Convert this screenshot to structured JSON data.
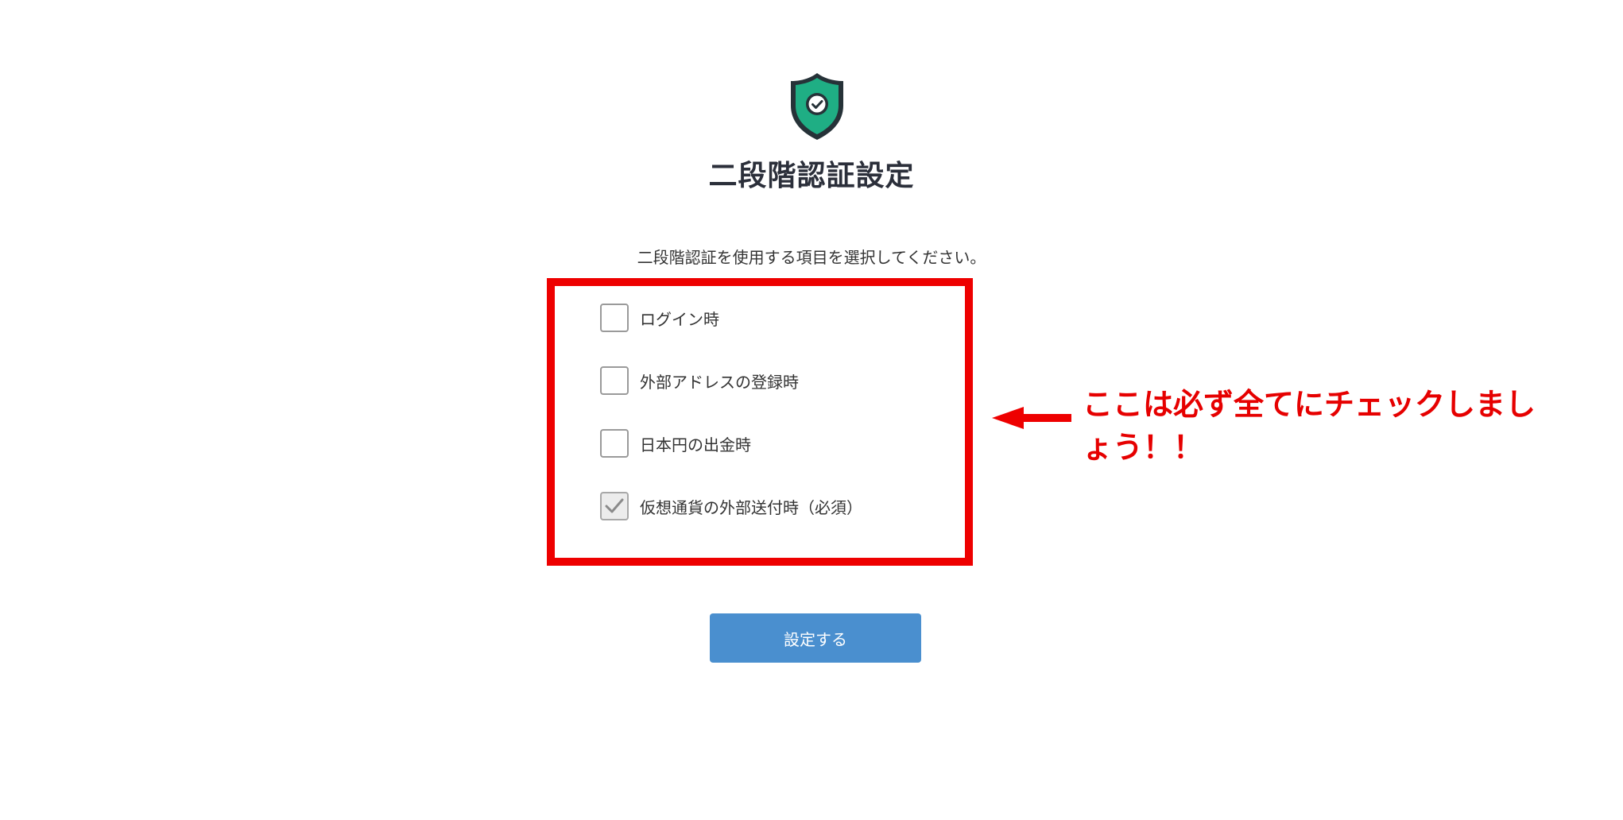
{
  "header": {
    "icon": "shield-check-icon",
    "title": "二段階認証設定"
  },
  "instruction": "二段階認証を使用する項目を選択してください。",
  "options": [
    {
      "label": "ログイン時",
      "checked": false
    },
    {
      "label": "外部アドレスの登録時",
      "checked": false
    },
    {
      "label": "日本円の出金時",
      "checked": false
    },
    {
      "label": "仮想通貨の外部送付時（必須）",
      "checked": true
    }
  ],
  "submit": {
    "label": "設定する"
  },
  "annotation": {
    "text": "ここは必ず全てにチェックしましょう！！",
    "color": "#e60000"
  },
  "colors": {
    "shield_fill": "#1fae84",
    "shield_outline": "#263238",
    "button": "#4a8fcf",
    "highlight": "#ee0000"
  }
}
